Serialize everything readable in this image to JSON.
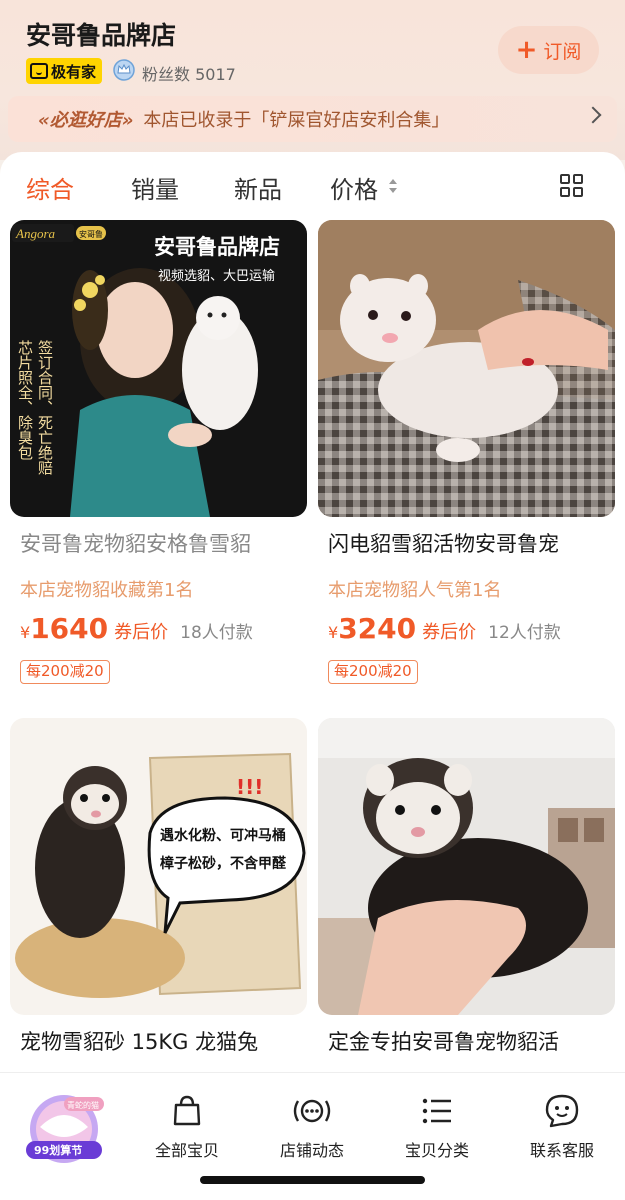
{
  "store": {
    "name": "安哥鲁品牌店",
    "badge_label": "极有家",
    "fans_text": "粉丝数 5017",
    "subscribe_label": "订阅"
  },
  "banner": {
    "tag": "必逛好店",
    "text": "本店已收录于「铲屎官好店安利合集」"
  },
  "tabs": [
    "综合",
    "销量",
    "新品",
    "价格"
  ],
  "active_tab": "综合",
  "products": [
    {
      "title": "安哥鲁宠物貂安格鲁雪貂",
      "rank": "本店宠物貂收藏第1名",
      "currency": "¥",
      "price": "1640",
      "after_coupon": "券后价",
      "buyers": "18人付款",
      "coupon": "每200减20",
      "photo": {
        "brand": "Angora",
        "brand_tag": "安哥鲁",
        "headline": "安哥鲁品牌店",
        "sub": "视频选貂、大巴运输",
        "side_text_1": "芯片照全、除臭包",
        "side_text_2": "签订合同、死亡绝赔"
      }
    },
    {
      "title": "闪电貂雪貂活物安哥鲁宠",
      "rank": "本店宠物貂人气第1名",
      "currency": "¥",
      "price": "3240",
      "after_coupon": "券后价",
      "buyers": "12人付款",
      "coupon": "每200减20"
    },
    {
      "title": "宠物雪貂砂 15KG 龙猫兔",
      "bubble_text_1": "遇水化粉、可冲马桶",
      "bubble_text_2": "樟子松砂，不含甲醛",
      "bubble_marks": "!!!"
    },
    {
      "title": "定金专拍安哥鲁宠物貂活"
    }
  ],
  "bottom_nav": {
    "promo_label": "99划算节",
    "promo_top": "青蛇的猫",
    "items": [
      "全部宝贝",
      "店铺动态",
      "宝贝分类",
      "联系客服"
    ]
  },
  "colors": {
    "accent": "#f05a28",
    "header_bg": "#f8e4da",
    "rank_text": "#e79c6d"
  }
}
